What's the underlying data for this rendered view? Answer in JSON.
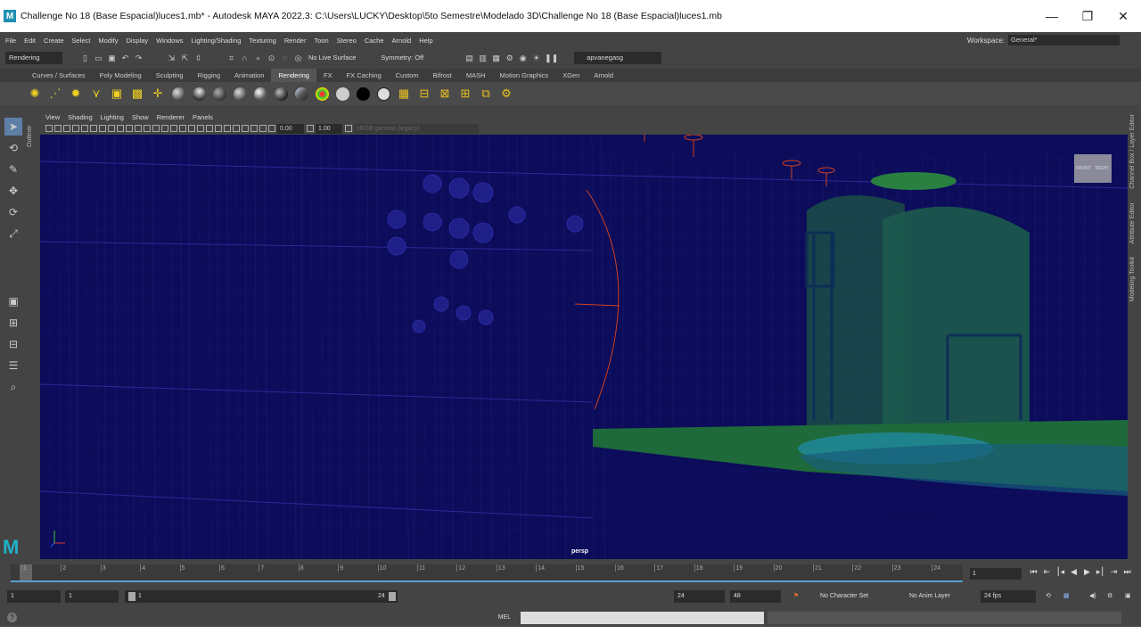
{
  "window": {
    "title": "Challenge No 18 (Base Espacial)luces1.mb* - Autodesk MAYA 2022.3: C:\\Users\\LUCKY\\Desktop\\5to Semestre\\Modelado 3D\\Challenge No 18 (Base Espacial)luces1.mb",
    "logo": "M",
    "minimize": "—",
    "maximize": "❐",
    "close": "✕"
  },
  "menubar": {
    "items": [
      "File",
      "Edit",
      "Create",
      "Select",
      "Modify",
      "Display",
      "Windows",
      "Lighting/Shading",
      "Texturing",
      "Render",
      "Toon",
      "Stereo",
      "Cache",
      "Arnold",
      "Help"
    ],
    "workspace_label": "Workspace:",
    "workspace_value": "General*"
  },
  "statusline": {
    "menuset": "Rendering",
    "live_surface": "No Live Surface",
    "symmetry": "Symmetry: Off",
    "user": "apvanegasg"
  },
  "shelf": {
    "tabs": [
      "Curves / Surfaces",
      "Poly Modeling",
      "Sculpting",
      "Rigging",
      "Animation",
      "Rendering",
      "FX",
      "FX Caching",
      "Custom",
      "Bifrost",
      "MASH",
      "Motion Graphics",
      "XGen",
      "Arnold"
    ],
    "active_tab": "Rendering"
  },
  "panel": {
    "menus": [
      "View",
      "Shading",
      "Lighting",
      "Show",
      "Renderer",
      "Panels"
    ],
    "exposure": "0.00",
    "gamma": "1.00",
    "color_space": "sRGB gamma (legacy)",
    "camera": "persp",
    "viewcube_left": "FRONT",
    "viewcube_right": "RIGHT"
  },
  "side": {
    "outliner": "Outliner",
    "right_tabs": [
      "Channel Box / Layer Editor",
      "Attribute Editor",
      "Modeling Toolkit"
    ]
  },
  "timeline": {
    "ticks": [
      "1",
      "2",
      "3",
      "4",
      "5",
      "6",
      "7",
      "8",
      "9",
      "10",
      "11",
      "12",
      "13",
      "14",
      "15",
      "16",
      "17",
      "18",
      "19",
      "20",
      "21",
      "22",
      "23",
      "24"
    ],
    "current_frame": "1",
    "start": "1",
    "anim_start": "1",
    "range_start": "1",
    "range_end": "24",
    "end": "24",
    "anim_end": "48",
    "character_set": "No Character Set",
    "anim_layer": "No Anim Layer",
    "fps": "24 fps"
  },
  "cmdline": {
    "language": "MEL",
    "help": "?"
  }
}
